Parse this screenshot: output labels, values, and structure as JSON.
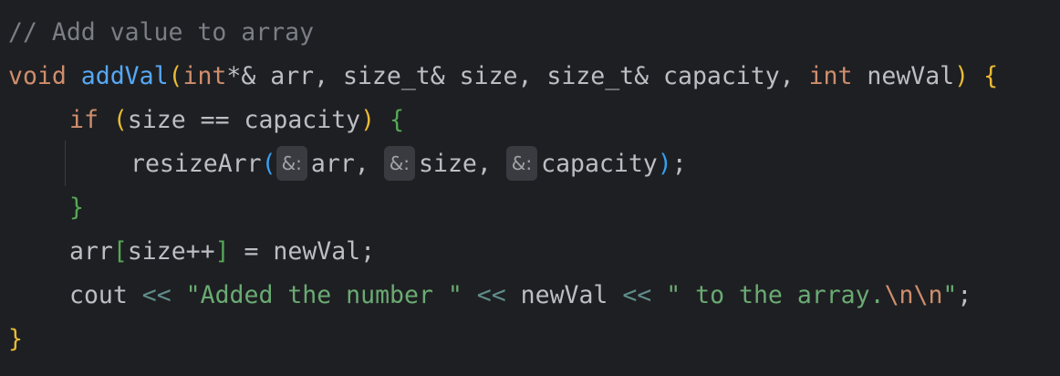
{
  "code": {
    "comment": "// Add value to array",
    "sig": {
      "kw_void": "void",
      "fn_name": "addVal",
      "paren_open": "(",
      "kw_int1": "int",
      "p1_type": "*& arr, ",
      "type_size1": "size_t",
      "p2_type": "& size, ",
      "type_size2": "size_t",
      "p3_type": "& capacity, ",
      "kw_int2": "int",
      "p4_name": " newVal",
      "paren_close": ")",
      "space": " ",
      "brace_open": "{"
    },
    "if_line": {
      "kw_if": "if",
      "space": " ",
      "paren_open": "(",
      "condition": "size == capacity",
      "paren_close": ")",
      "space2": " ",
      "brace_open": "{"
    },
    "resize_line": {
      "fn": "resizeArr",
      "paren_open": "(",
      "hint1": "&:",
      "arg1": "arr, ",
      "hint2": "&:",
      "arg2": "size, ",
      "hint3": "&:",
      "arg3": "capacity",
      "paren_close": ")",
      "semi": ";"
    },
    "if_close": "}",
    "assign_line": {
      "lhs_name": "arr",
      "bracket_open": "[",
      "index": "size++",
      "bracket_close": "]",
      "rest": " = newVal;"
    },
    "cout_line": {
      "cout": "cout ",
      "op1": "<<",
      "sp1": " ",
      "str1": "\"Added the number \"",
      "sp2": " ",
      "op2": "<<",
      "mid": " newVal ",
      "op3": "<<",
      "sp3": " ",
      "str2": "\" to the array.",
      "esc1": "\\n",
      "esc2": "\\n",
      "str2_end": "\"",
      "semi": ";"
    },
    "fn_close": "}"
  }
}
